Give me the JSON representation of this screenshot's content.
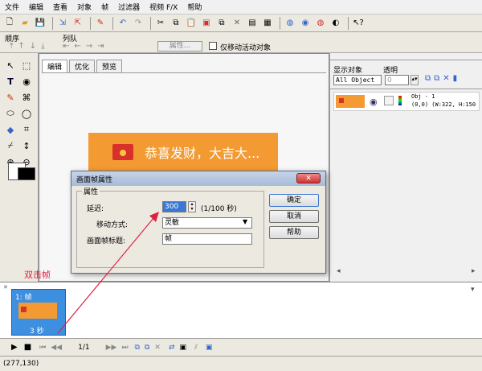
{
  "menu": [
    "文件",
    "编辑",
    "查看",
    "对象",
    "帧",
    "过滤器",
    "视频 F/X",
    "帮助"
  ],
  "toolbar2": {
    "order_label": "顺序",
    "queue_label": "列队",
    "props_button": "属性...",
    "move_active_checkbox": "仅移动活动对象"
  },
  "tabs": [
    "编辑",
    "优化",
    "预览"
  ],
  "canvas": {
    "banner_text": "恭喜发财，大吉大..."
  },
  "right_panel": {
    "show_objects_label": "显示对象",
    "opacity_label": "透明",
    "objects_select": "All Object",
    "opacity_value": "0",
    "obj_name": "Obj - 1",
    "obj_info": "(0,0) (W:322, H:150"
  },
  "dialog": {
    "title": "画面帧属性",
    "group_label": "属性",
    "delay_label": "延迟:",
    "delay_value": "300",
    "delay_unit": "(1/100 秒)",
    "move_label": "移动方式:",
    "move_value": "灵敏",
    "title_label": "画面帧标题:",
    "title_value": "帧",
    "ok_button": "确定",
    "cancel_button": "取消",
    "help_button": "帮助"
  },
  "annotation": "双击帧",
  "frame": {
    "label": "1: 帧",
    "duration": "3 秒"
  },
  "playbar": {
    "page": "1/1"
  },
  "status": "(277,130)",
  "colors": {
    "frame_bg": "#3d8fe0",
    "banner_bg": "#f39b32",
    "banner_red": "#d8312b",
    "arrow": "#e02040"
  }
}
